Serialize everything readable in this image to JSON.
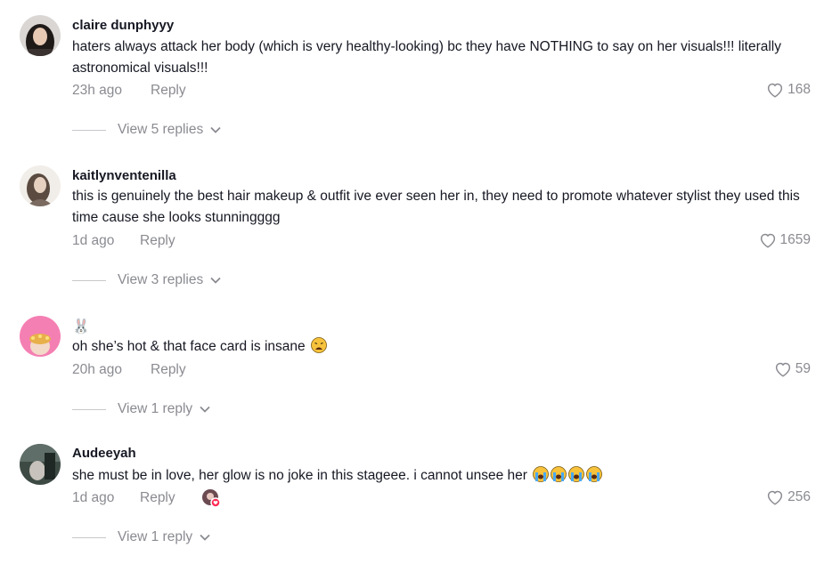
{
  "comments": [
    {
      "username": "claire dunphyyy",
      "text": "haters always attack her body (which is very healthy-looking) bc they have NOTHING to say on her visuals!!! literally astronomical visuals!!!",
      "time": "23h ago",
      "reply_label": "Reply",
      "likes": "168",
      "view_replies": "View 5 replies"
    },
    {
      "username": "kaitlynventenilla",
      "text": "this is genuinely the best hair makeup & outfit ive ever seen her in, they need to promote whatever stylist they used this time cause she looks stunningggg",
      "time": "1d ago",
      "reply_label": "Reply",
      "likes": "1659",
      "view_replies": "View 3 replies"
    },
    {
      "username": "🐰",
      "text": "oh she’s hot & that face card is insane",
      "time": "20h ago",
      "reply_label": "Reply",
      "likes": "59",
      "view_replies": "View 1 reply"
    },
    {
      "username": "Audeeyah",
      "text": "she must be in love, her glow is no joke in this stageee. i cannot unsee her",
      "time": "1d ago",
      "reply_label": "Reply",
      "likes": "256",
      "view_replies": "View 1 reply"
    }
  ],
  "icons": {
    "like": "heart-outline-icon",
    "expand": "chevron-down-icon",
    "emoji_weary": "weary-face-emoji",
    "emoji_crying": "loudly-crying-face-emoji"
  },
  "colors": {
    "text": "#161823",
    "muted": "#8a8b91",
    "creator_badge": "#fe2c55"
  }
}
